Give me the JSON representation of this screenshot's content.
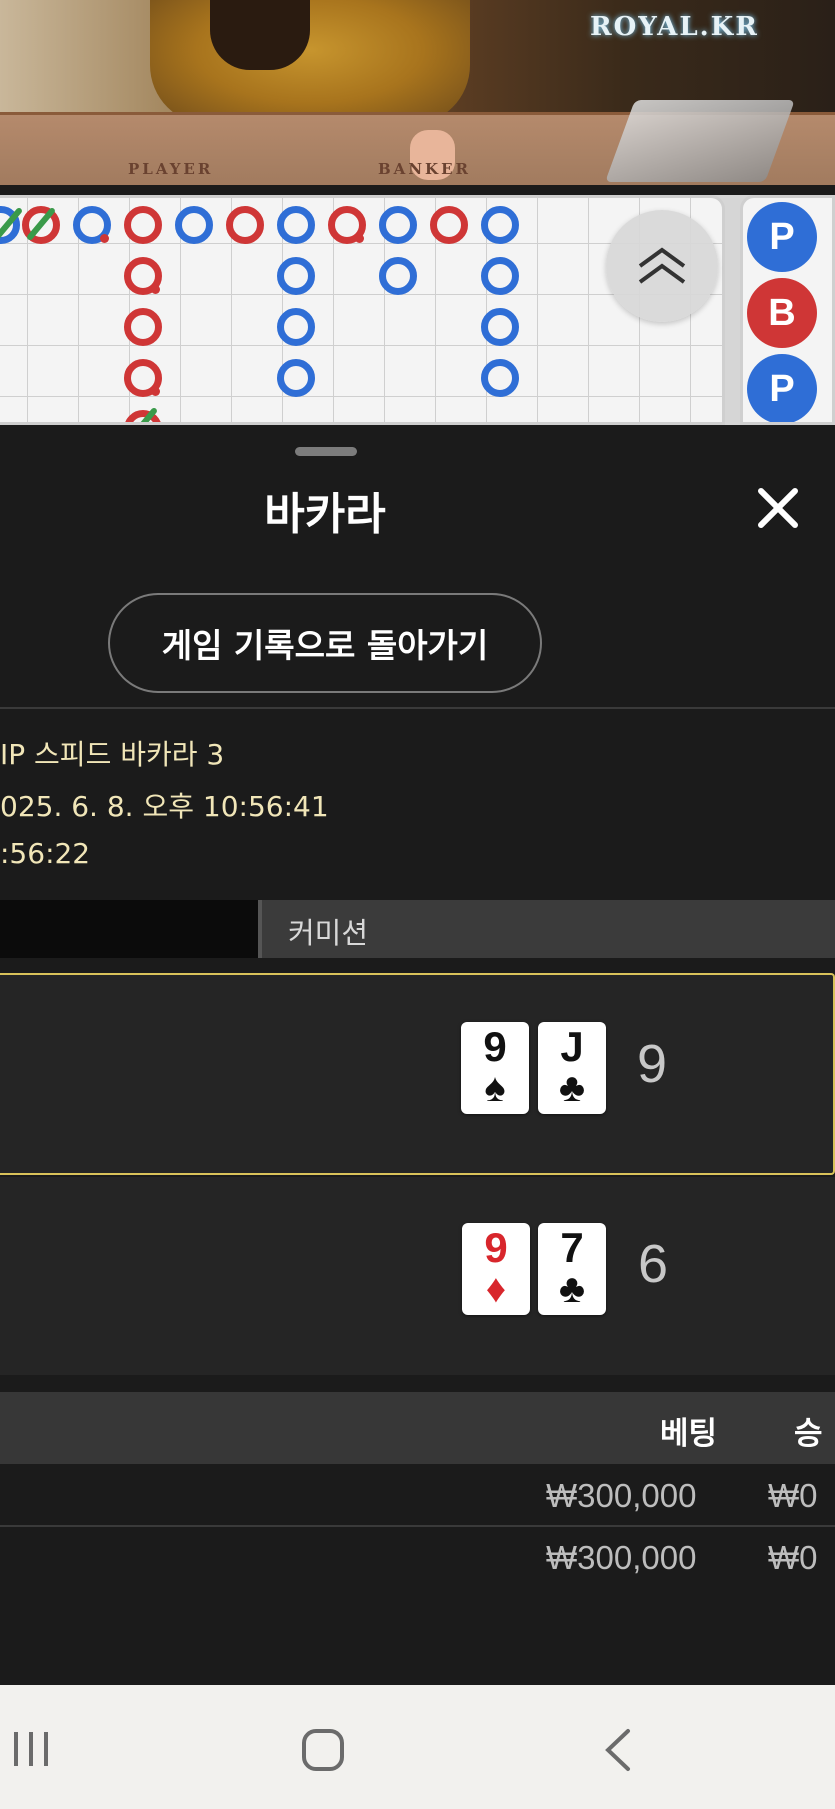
{
  "video": {
    "brand": "ROYAL.KR",
    "table_labels": [
      "PLAYER",
      "BANKER"
    ]
  },
  "roadmap": {
    "bead_road": [
      "P",
      "B",
      "P"
    ],
    "scroll_icon": "chevron-double-up-icon"
  },
  "panel": {
    "title": "바카라",
    "close_icon": "close-icon",
    "back_button": "게임 기록으로 돌아가기",
    "game_name": "IP 스피드 바카라 3",
    "datetime": "025. 6. 8. 오후 10:56:41",
    "time2": ":56:22",
    "tab_label": "커미션",
    "hands": [
      {
        "cards": [
          {
            "rank": "9",
            "suit": "♠",
            "color": "black"
          },
          {
            "rank": "J",
            "suit": "♣",
            "color": "black"
          }
        ],
        "score": "9",
        "winner": true
      },
      {
        "cards": [
          {
            "rank": "9",
            "suit": "♦",
            "color": "red"
          },
          {
            "rank": "7",
            "suit": "♣",
            "color": "black"
          }
        ],
        "score": "6",
        "winner": false
      }
    ],
    "bet_table": {
      "headers": [
        "베팅",
        "승"
      ],
      "rows": [
        {
          "bet": "₩300,000",
          "win": "₩0"
        },
        {
          "bet": "₩300,000",
          "win": "₩0"
        }
      ]
    }
  },
  "navbar": {
    "icons": [
      "recent-apps-icon",
      "home-icon",
      "back-icon"
    ]
  }
}
